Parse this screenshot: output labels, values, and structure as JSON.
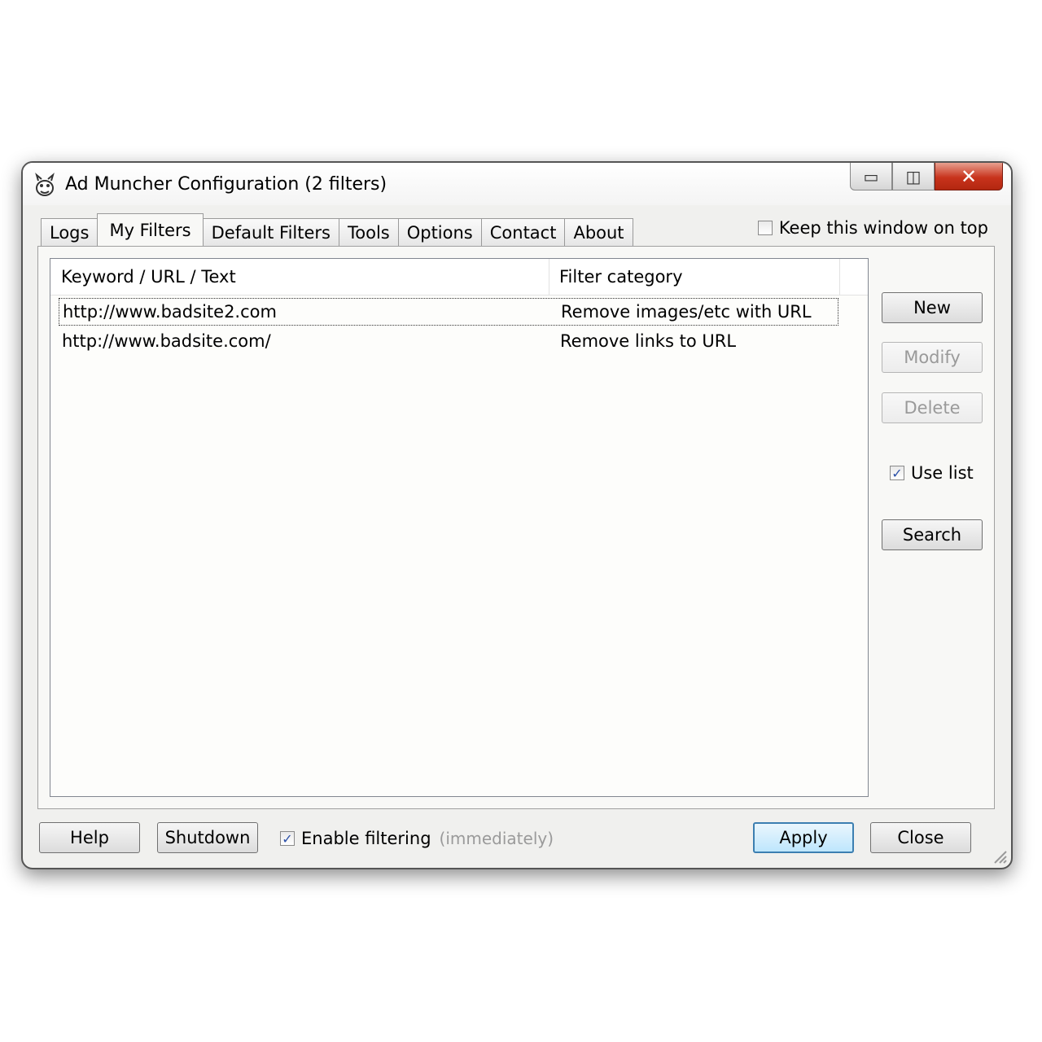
{
  "window": {
    "title": "Ad Muncher Configuration (2 filters)"
  },
  "caption": {
    "minimize": "▭",
    "maximize": "◫",
    "close": "✕"
  },
  "tabs": [
    {
      "label": "Logs"
    },
    {
      "label": "My Filters"
    },
    {
      "label": "Default Filters"
    },
    {
      "label": "Tools"
    },
    {
      "label": "Options"
    },
    {
      "label": "Contact"
    },
    {
      "label": "About"
    }
  ],
  "active_tab": "My Filters",
  "keep_on_top": {
    "label": "Keep this window on top",
    "checked": false
  },
  "list": {
    "columns": [
      "Keyword / URL / Text",
      "Filter category"
    ],
    "rows": [
      {
        "keyword": "http://www.badsite2.com",
        "category": "Remove images/etc with URL"
      },
      {
        "keyword": "http://www.badsite.com/",
        "category": "Remove links to URL"
      }
    ]
  },
  "side": {
    "new": "New",
    "modify": "Modify",
    "delete": "Delete",
    "use_list": {
      "label": "Use list",
      "checked": true
    },
    "search": "Search"
  },
  "bottom": {
    "help": "Help",
    "shutdown": "Shutdown",
    "enable_filtering": {
      "label": "Enable filtering",
      "checked": true
    },
    "immediately": "(immediately)",
    "apply": "Apply",
    "close": "Close"
  },
  "check_glyph": "✓",
  "colors": {
    "close_button": "#c8331c",
    "default_button_border": "#3c7fb1",
    "disabled_text": "#9a9a9a"
  }
}
